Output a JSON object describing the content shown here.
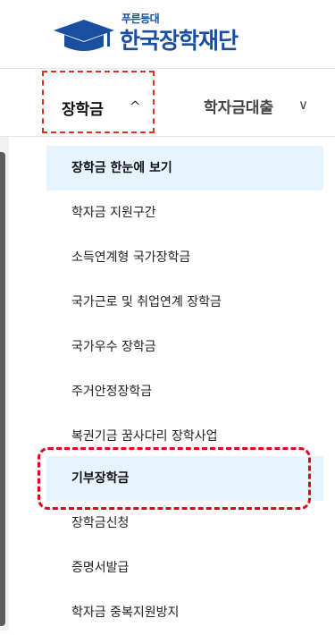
{
  "logo": {
    "small_text": "푸른등대",
    "brand_name": "한국장학재단"
  },
  "tabs": [
    {
      "label": "장학금",
      "chevron": "^"
    },
    {
      "label": "학자금대출",
      "chevron": "∨"
    }
  ],
  "menu": {
    "items": [
      {
        "label": "장학금 한눈에 보기"
      },
      {
        "label": "학자금 지원구간"
      },
      {
        "label": "소득연계형 국가장학금"
      },
      {
        "label": "국가근로 및 취업연계 장학금"
      },
      {
        "label": "국가우수 장학금"
      },
      {
        "label": "주거안정장학금"
      },
      {
        "label": "복권기금 꿈사다리 장학사업"
      },
      {
        "label": "기부장학금"
      },
      {
        "label": "장학금신청"
      },
      {
        "label": "증명서발급"
      },
      {
        "label": "학자금 중복지원방지"
      }
    ]
  },
  "colors": {
    "brand": "#1a4fa0",
    "active_bg": "#e7f3fd",
    "highlight": "#e0001a"
  }
}
